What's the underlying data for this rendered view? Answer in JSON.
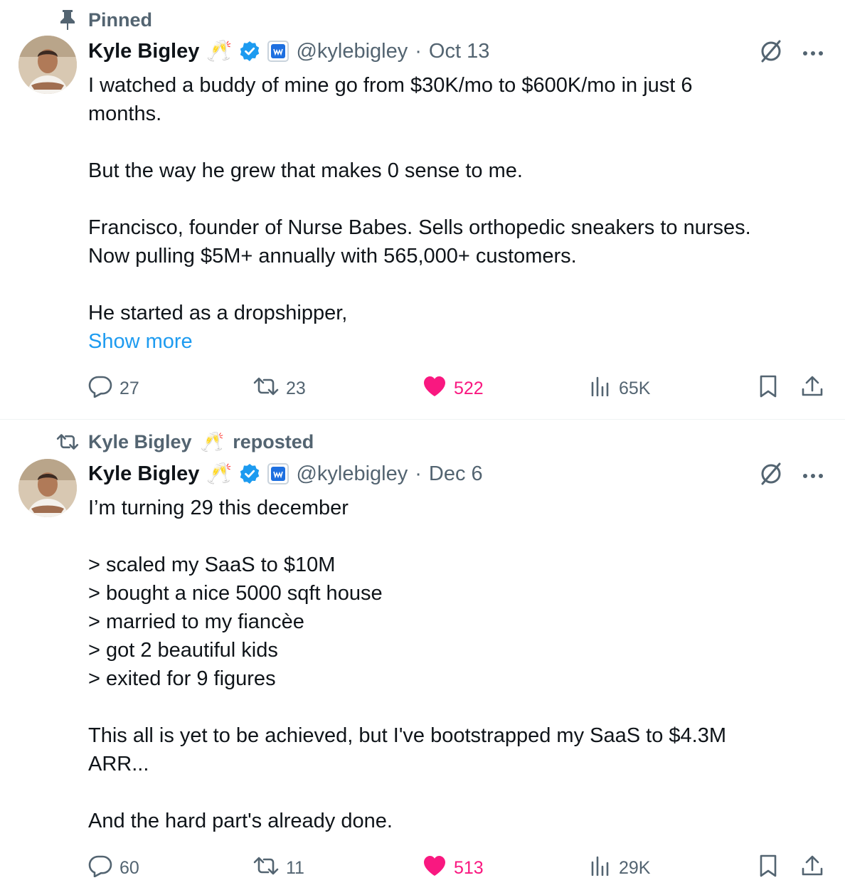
{
  "colors": {
    "text": "#0f1419",
    "secondary": "#536471",
    "link": "#1d9bf0",
    "like": "#f91880",
    "verified": "#1d9bf0",
    "divider": "#eff3f4"
  },
  "tweets": [
    {
      "context": {
        "icon": "pin-icon",
        "label": "Pinned"
      },
      "author": {
        "name": "Kyle Bigley",
        "emoji": "🥂",
        "handle": "@kylebigley",
        "separator": "·",
        "date": "Oct 13"
      },
      "paragraphs": [
        "I watched a buddy of mine go from $30K/mo to $600K/mo in just 6\nmonths.",
        "But the way he grew that makes 0 sense to me.",
        "Francisco, founder of Nurse Babes. Sells orthopedic sneakers to nurses.\nNow pulling $5M+ annually with 565,000+ customers.",
        "He started as a dropshipper,"
      ],
      "show_more": "Show more",
      "stats": {
        "replies": "27",
        "reposts": "23",
        "likes": "522",
        "views": "65K"
      }
    },
    {
      "context": {
        "icon": "repost-icon",
        "name": "Kyle Bigley",
        "emoji": "🥂",
        "label": "reposted"
      },
      "author": {
        "name": "Kyle Bigley",
        "emoji": "🥂",
        "handle": "@kylebigley",
        "separator": "·",
        "date": "Dec 6"
      },
      "paragraphs": [
        "I’m turning 29 this december",
        "> scaled my SaaS to $10M\n> bought a nice 5000 sqft house\n> married to my fiancèe\n> got 2 beautiful kids\n> exited for 9 figures",
        "This all is yet to be achieved, but I've bootstrapped my SaaS to $4.3M\nARR...",
        "And the hard part's already done."
      ],
      "stats": {
        "replies": "60",
        "reposts": "11",
        "likes": "513",
        "views": "29K"
      }
    }
  ]
}
